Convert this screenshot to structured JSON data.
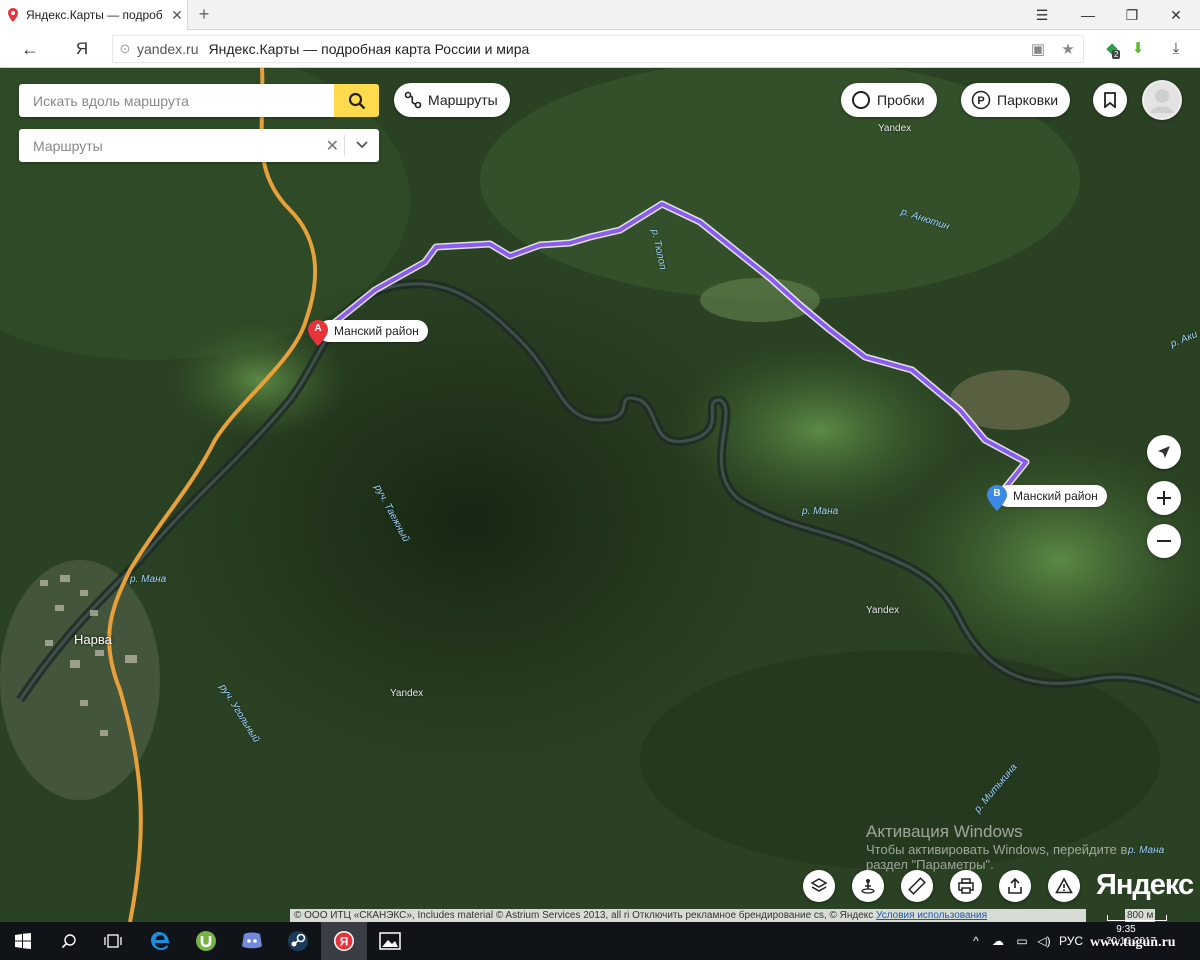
{
  "browser": {
    "tab_title": "Яндекс.Карты — подроб",
    "url_domain": "yandex.ru",
    "page_title": "Яндекс.Карты — подробная карта России и мира",
    "ya_button": "Я",
    "extension_badge": "2"
  },
  "search": {
    "placeholder": "Искать вдоль маршрута"
  },
  "route_select": {
    "placeholder": "Маршруты"
  },
  "top_buttons": {
    "routes": "Маршруты",
    "traffic": "Пробки",
    "parking": "Парковки"
  },
  "markers": {
    "a_letter": "A",
    "a_label": "Манский район",
    "b_letter": "B",
    "b_label": "Манский район"
  },
  "map_labels": {
    "yandex_wm1": "Yandex",
    "yandex_wm2": "Yandex",
    "yandex_wm3": "Yandex",
    "river_anyutin": "р. Анютин",
    "river_tyulop": "р. Тюлоп",
    "river_aki": "р. Аки",
    "river_mana_center": "р. Мана",
    "river_mana_left": "р. Мана",
    "river_mana_right": "р. Мана",
    "stream_taezhny": "руч. Таежный",
    "stream_ugolny": "руч. Угольный",
    "river_mitkina": "р. Митькина",
    "town_narva": "Нарва"
  },
  "activation": {
    "title": "Активация Windows",
    "line1": "Чтобы активировать Windows, перейдите в",
    "line2": "раздел \"Параметры\"."
  },
  "footer": {
    "copyright": "© ООО ИТЦ «СКАНЭКС», Includes material © Astrium Services 2013, all ri",
    "ad_off": "Отключить рекламное брендирование",
    "copyright2": "cs, © Яндекс",
    "terms": "Условия использования",
    "scale": "800 м",
    "logo": "Яндекс"
  },
  "taskbar": {
    "lang": "РУС",
    "time": "9:35",
    "date": "20.10.2017",
    "watermark": "www.tugun.ru"
  },
  "colors": {
    "route": "#8c5cf2",
    "road": "#e8a13a",
    "search_accent": "#ffdb4d",
    "marker_a": "#e8333b",
    "marker_b": "#3d8ae6"
  }
}
